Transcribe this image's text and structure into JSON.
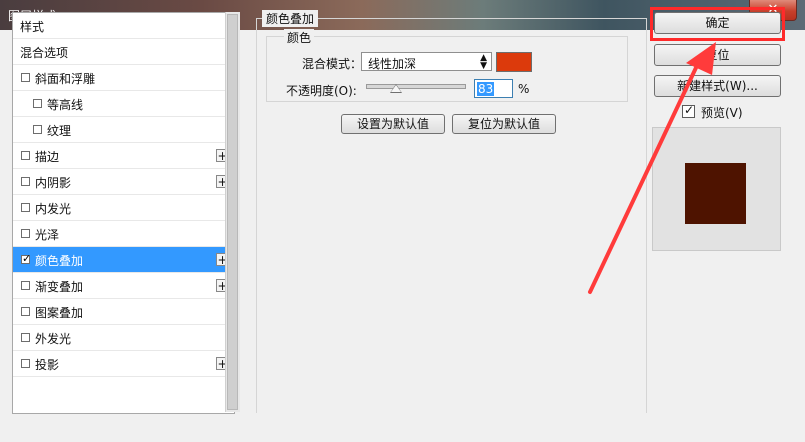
{
  "window": {
    "title": "图层样式",
    "close_glyph": "✕"
  },
  "style_list": {
    "items": [
      {
        "label": "样式",
        "checkbox": false,
        "checked": false,
        "plus": false,
        "selected": false,
        "indent": 0
      },
      {
        "label": "混合选项",
        "checkbox": false,
        "checked": false,
        "plus": false,
        "selected": false,
        "indent": 0
      },
      {
        "label": "斜面和浮雕",
        "checkbox": true,
        "checked": false,
        "plus": false,
        "selected": false,
        "indent": 0
      },
      {
        "label": "等高线",
        "checkbox": true,
        "checked": false,
        "plus": false,
        "selected": false,
        "indent": 1
      },
      {
        "label": "纹理",
        "checkbox": true,
        "checked": false,
        "plus": false,
        "selected": false,
        "indent": 1
      },
      {
        "label": "描边",
        "checkbox": true,
        "checked": false,
        "plus": true,
        "selected": false,
        "indent": 0
      },
      {
        "label": "内阴影",
        "checkbox": true,
        "checked": false,
        "plus": true,
        "selected": false,
        "indent": 0
      },
      {
        "label": "内发光",
        "checkbox": true,
        "checked": false,
        "plus": false,
        "selected": false,
        "indent": 0
      },
      {
        "label": "光泽",
        "checkbox": true,
        "checked": false,
        "plus": false,
        "selected": false,
        "indent": 0
      },
      {
        "label": "颜色叠加",
        "checkbox": true,
        "checked": true,
        "plus": true,
        "selected": true,
        "indent": 0
      },
      {
        "label": "渐变叠加",
        "checkbox": true,
        "checked": false,
        "plus": true,
        "selected": false,
        "indent": 0
      },
      {
        "label": "图案叠加",
        "checkbox": true,
        "checked": false,
        "plus": false,
        "selected": false,
        "indent": 0
      },
      {
        "label": "外发光",
        "checkbox": true,
        "checked": false,
        "plus": false,
        "selected": false,
        "indent": 0
      },
      {
        "label": "投影",
        "checkbox": true,
        "checked": false,
        "plus": true,
        "selected": false,
        "indent": 0
      }
    ],
    "plus_glyph": "+"
  },
  "color_overlay": {
    "group_title": "颜色叠加",
    "subgroup_title": "颜色",
    "blend_mode_label": "混合模式：",
    "blend_mode_value": "线性加深",
    "select_arrows": "▲▼",
    "overlay_color": "#dc3a0c",
    "opacity_label": "不透明度(O):",
    "opacity_value": "83",
    "opacity_unit": "%",
    "set_default_label": "设置为默认值",
    "reset_default_label": "复位为默认值"
  },
  "actions": {
    "ok_label": "确定",
    "reset_label": "复位",
    "new_style_label": "新建样式(W)...",
    "preview_label": "预览(V)",
    "preview_checked": true,
    "preview_color": "#4e1300"
  },
  "annotation": {
    "outline_color": "#ff2a2a",
    "arrow_color": "#ff3b3b"
  }
}
